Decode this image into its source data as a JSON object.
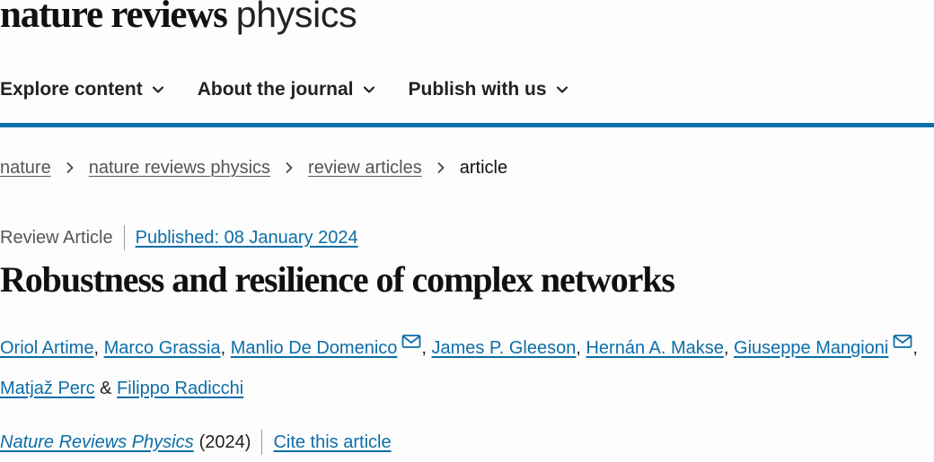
{
  "brand": {
    "bold": "nature reviews",
    "light": "physics"
  },
  "nav": {
    "items": [
      {
        "label": "Explore content"
      },
      {
        "label": "About the journal"
      },
      {
        "label": "Publish with us"
      }
    ]
  },
  "breadcrumb": {
    "items": [
      "nature",
      "nature reviews physics",
      "review articles"
    ],
    "current": "article"
  },
  "article": {
    "type": "Review Article",
    "published": "Published: 08 January 2024",
    "title": "Robustness and resilience of complex networks",
    "authors": [
      "Oriol Artime",
      "Marco Grassia",
      "Manlio De Domenico",
      "James P. Gleeson",
      "Hernán A. Makse",
      "Giuseppe Mangioni",
      "Matjaž Perc",
      "Filippo Radicchi"
    ],
    "separator": ", ",
    "last_separator": " & ",
    "journal": "Nature Reviews Physics",
    "year": "(2024)",
    "cite_label": "Cite this article"
  },
  "colors": {
    "accent": "#0c6ea8",
    "text": "#222222",
    "muted": "#555555"
  },
  "icons": {
    "nav": "chevron-down-icon",
    "breadcrumb": "chevron-right-icon",
    "corresponding_author": "mail-icon"
  }
}
